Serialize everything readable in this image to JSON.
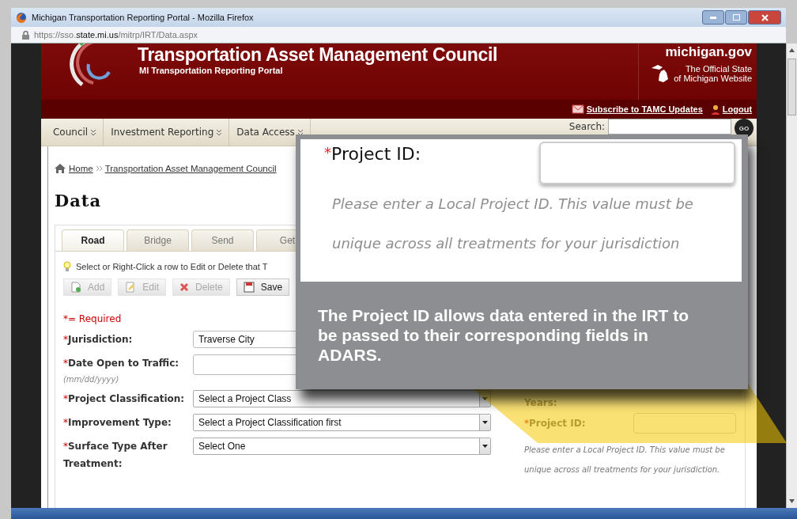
{
  "window": {
    "title": "Michigan Transportation Reporting Portal - Mozilla Firefox",
    "url_scheme": "https://sso.",
    "url_domain": "state.mi.us",
    "url_path": "/mitrp/IRT/Data.aspx"
  },
  "header": {
    "title": "Transportation Asset Management Council",
    "subtitle": "MI Transportation Reporting Portal",
    "site": "michigan.gov",
    "official": [
      "The Official State",
      "of Michigan Website"
    ],
    "links": [
      {
        "label": "Subscribe to TAMC Updates",
        "kind": "mail"
      },
      {
        "label": "Logout",
        "kind": "user"
      }
    ]
  },
  "nav": {
    "items": [
      {
        "label": "Council"
      },
      {
        "label": "Investment Reporting"
      },
      {
        "label": "Data Access"
      }
    ],
    "search_label": "Search:",
    "go": "GO"
  },
  "breadcrumb": [
    "Home",
    "Transportation Asset Management Council"
  ],
  "page_title": "Data",
  "tabs": [
    {
      "label": "Road",
      "selected": true
    },
    {
      "label": "Bridge",
      "selected": false
    },
    {
      "label": "Send",
      "selected": false
    },
    {
      "label": "Get",
      "selected": false
    }
  ],
  "hint": "Select or Right-Click a row to Edit or Delete that T",
  "toolbar": [
    {
      "label": "Add",
      "kind": "add",
      "disabled": true
    },
    {
      "label": "Edit",
      "kind": "edit",
      "disabled": true
    },
    {
      "label": "Delete",
      "kind": "delete",
      "disabled": true
    },
    {
      "label": "Save",
      "kind": "save",
      "disabled": false
    }
  ],
  "required_mark": "*",
  "required_note": "= Required",
  "fields": [
    {
      "label": "Jurisdiction:",
      "kind": "text",
      "value": "Traverse City"
    },
    {
      "label": "Date Open to Traffic:",
      "kind": "text",
      "hint": "(mm/dd/yyyy)"
    },
    {
      "label": "Project Classification:",
      "kind": "select",
      "value": "Select a Project Class"
    },
    {
      "label": "Improvement Type:",
      "kind": "select",
      "value": "Select a Project Classification first"
    },
    {
      "label": "Surface Type After Treatment:",
      "kind": "select",
      "value": "Select One"
    }
  ],
  "side": {
    "years_label": "Years:",
    "project_id_label": "Project ID:",
    "help": [
      "Please enter a Local Project ID. This value must be",
      "unique across all treatments for your jurisdiction."
    ]
  },
  "callout": {
    "label": "Project ID:",
    "help": [
      "Please enter a Local Project ID. This value must be",
      "unique across all treatments for your jurisdiction"
    ],
    "note": "The Project ID allows data entered in the IRT to be passed to their corresponding fields in ADARS."
  }
}
